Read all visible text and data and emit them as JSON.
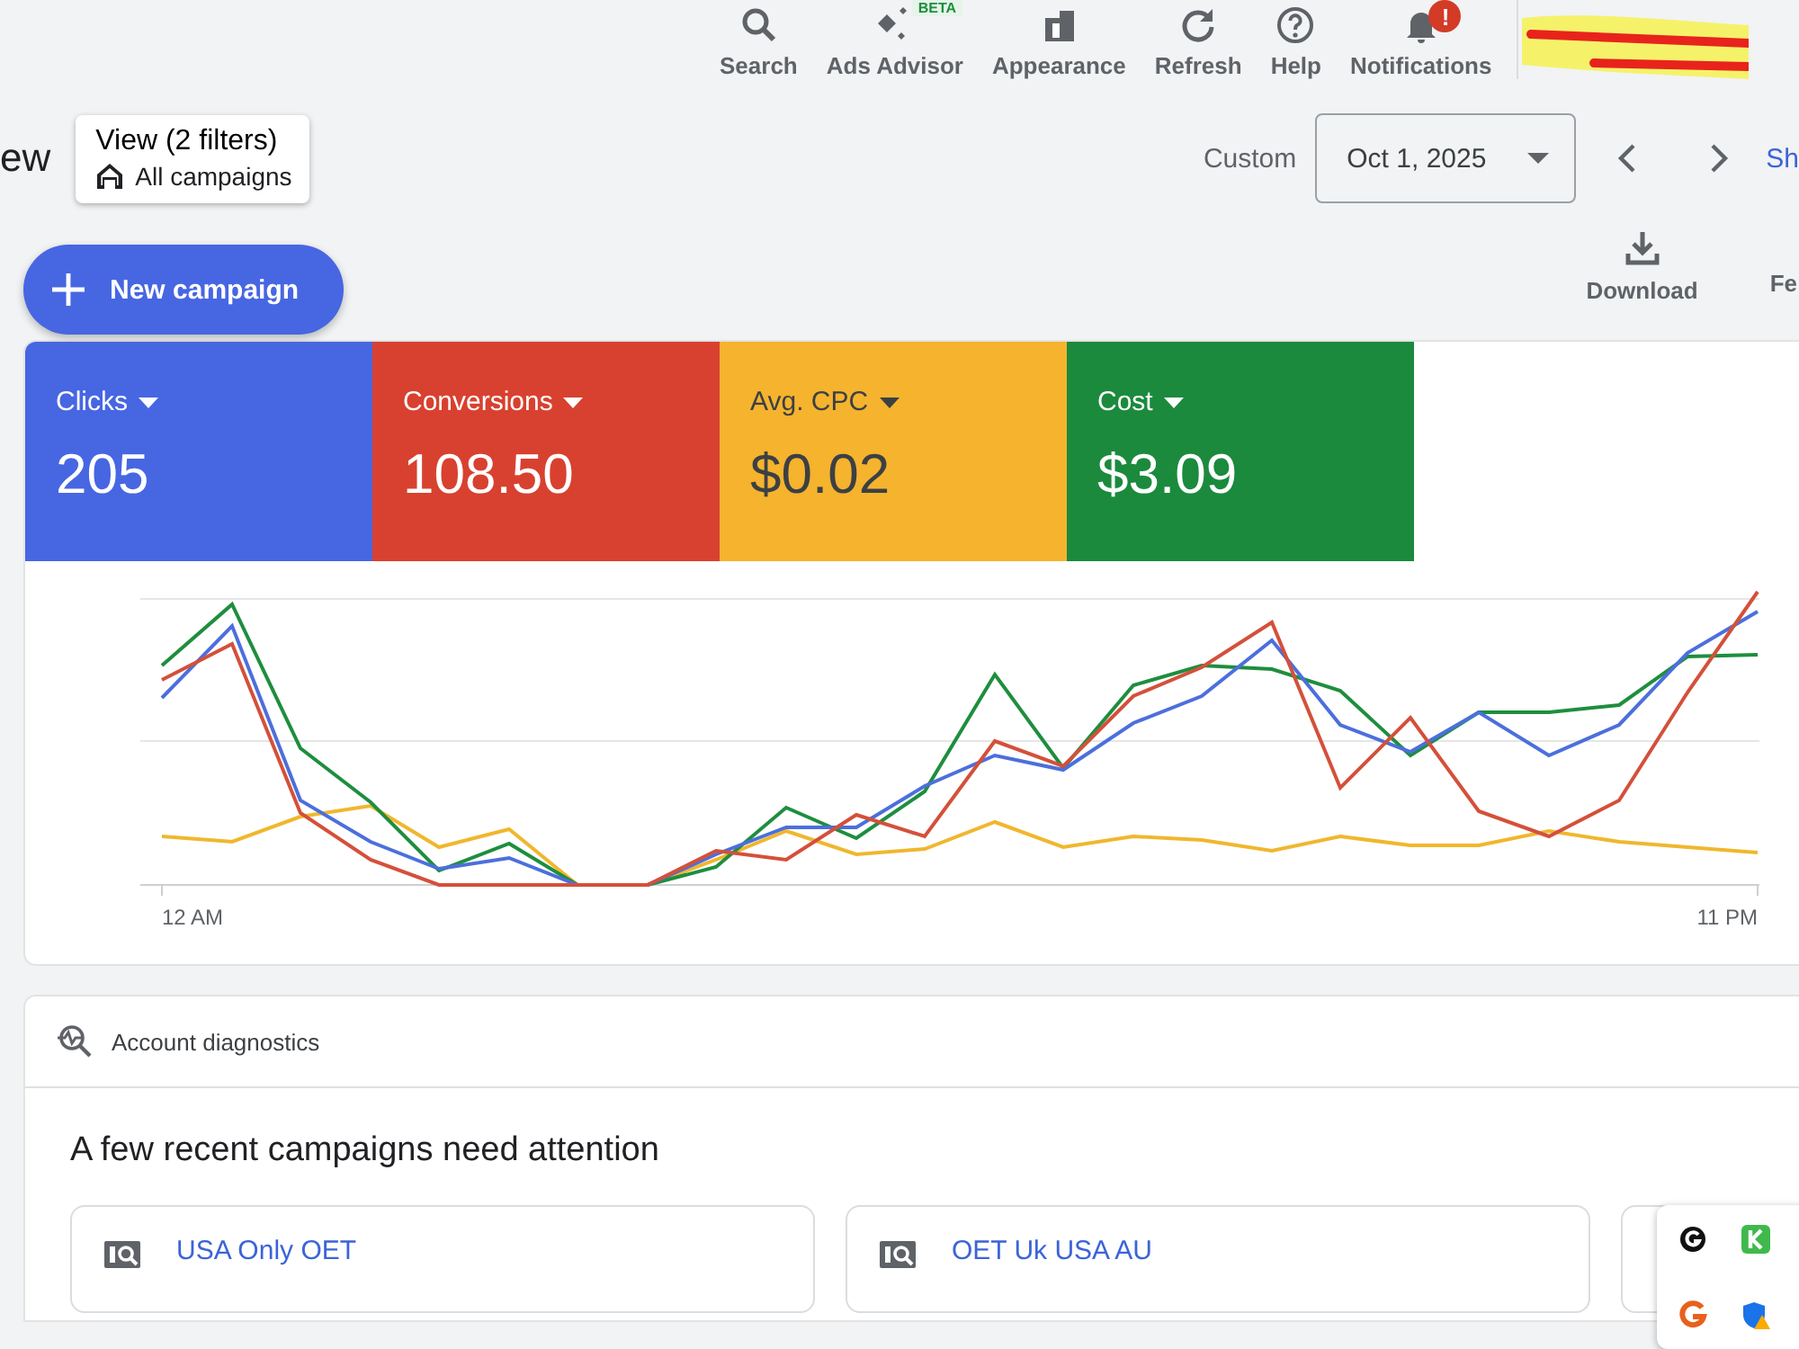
{
  "toolbar": [
    {
      "label": "Search",
      "kind": "search"
    },
    {
      "label": "Ads Advisor",
      "kind": "advisor",
      "badge": {
        "text": "BETA",
        "kind": "beta"
      }
    },
    {
      "label": "Appearance",
      "kind": "appearance"
    },
    {
      "label": "Refresh",
      "kind": "refresh"
    },
    {
      "label": "Help",
      "kind": "help"
    },
    {
      "label": "Notifications",
      "kind": "notifications",
      "badge": {
        "text": "!",
        "kind": "alert"
      }
    }
  ],
  "page_title": "ew",
  "view_filter": {
    "caption": "View (2 filters)",
    "value": "All campaigns"
  },
  "date_range": {
    "label": "Custom",
    "value": "Oct 1, 2025",
    "next_link": "Sh"
  },
  "new_campaign_button": "New campaign",
  "actions": [
    {
      "label": "Download",
      "kind": "download"
    },
    {
      "label": "Fe",
      "kind": "cut"
    }
  ],
  "metrics": [
    {
      "label": "Clicks",
      "value": "205",
      "color": "#4766e2"
    },
    {
      "label": "Conversions",
      "value": "108.50",
      "color": "#d8412f"
    },
    {
      "label": "Avg. CPC",
      "value": "$0.02",
      "color": "#f5b32e"
    },
    {
      "label": "Cost",
      "value": "$3.09",
      "color": "#1b8a3d"
    }
  ],
  "chart": {
    "x_labels": [
      "12 AM",
      "11 PM"
    ]
  },
  "diagnostics": {
    "title": "Account diagnostics",
    "heading": "A few recent campaigns need attention",
    "campaigns": [
      {
        "name": "USA Only OET"
      },
      {
        "name": "OET Uk USA AU"
      }
    ]
  }
}
